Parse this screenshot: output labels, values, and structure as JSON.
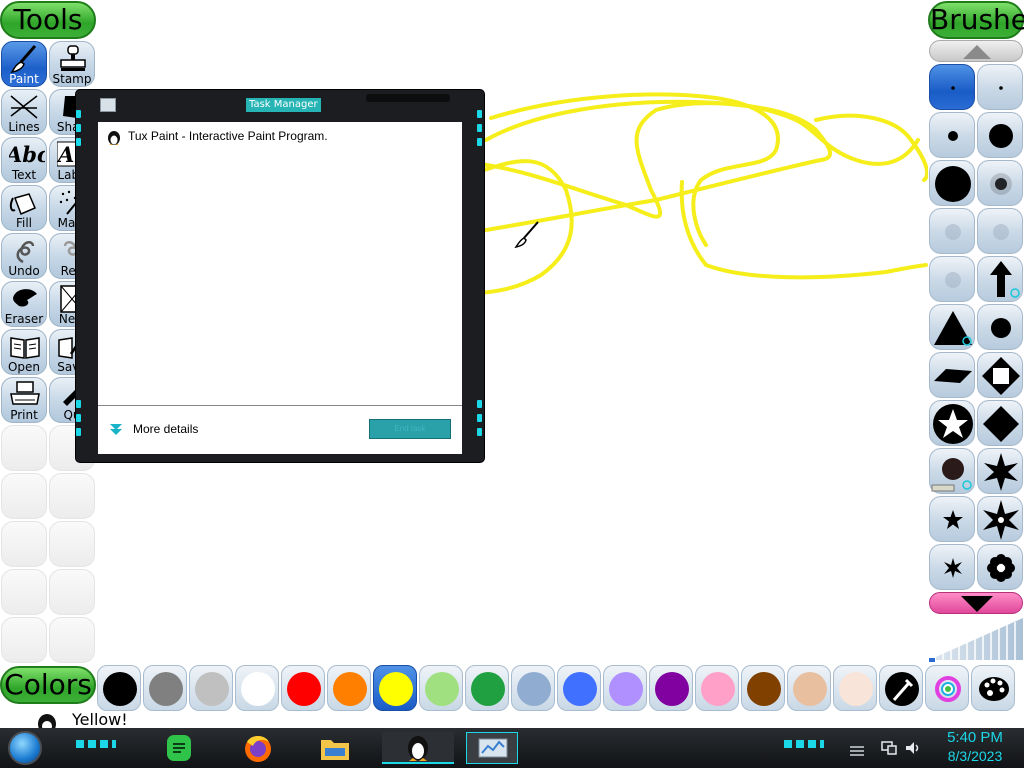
{
  "toolbar_left": {
    "header": "Tools",
    "tools": [
      {
        "label": "Paint",
        "icon": "paintbrush-icon",
        "selected": true
      },
      {
        "label": "Stamp",
        "icon": "stamp-icon"
      },
      {
        "label": "Lines",
        "icon": "lines-icon"
      },
      {
        "label": "Shap",
        "icon": "shapes-icon"
      },
      {
        "label": "Text",
        "icon": "text-icon",
        "glyph": "Abc"
      },
      {
        "label": "Labe",
        "icon": "label-icon",
        "glyph": "Ab"
      },
      {
        "label": "Fill",
        "icon": "fill-bucket-icon"
      },
      {
        "label": "Magi",
        "icon": "magic-wand-icon"
      },
      {
        "label": "Undo",
        "icon": "undo-icon"
      },
      {
        "label": "Red",
        "icon": "redo-icon"
      },
      {
        "label": "Eraser",
        "icon": "eraser-icon"
      },
      {
        "label": "New",
        "icon": "new-page-icon"
      },
      {
        "label": "Open",
        "icon": "open-book-icon"
      },
      {
        "label": "Save",
        "icon": "save-icon"
      },
      {
        "label": "Print",
        "icon": "printer-icon"
      },
      {
        "label": "Qu",
        "icon": "quit-icon"
      }
    ]
  },
  "toolbar_right": {
    "header": "Brushes"
  },
  "colors": {
    "header": "Colors",
    "swatches": [
      "#000000",
      "#808080",
      "#c0c0c0",
      "#ffffff",
      "#ff0000",
      "#ff8000",
      "#ffff00",
      "#a0e080",
      "#20a040",
      "#90acd0",
      "#4070ff",
      "#b090ff",
      "#8000a0",
      "#ff a0c8",
      "#804000",
      "#e8c0a0",
      "#f8e4d8"
    ],
    "selected_index": 6
  },
  "status": {
    "text": "Yellow!"
  },
  "task_manager": {
    "title": "Task Manager",
    "app_entry": "Tux Paint - Interactive Paint Program.",
    "more_details": "More details",
    "end_task_button": "End task"
  },
  "taskbar": {
    "time": "5:40 PM",
    "date": "8/3/2023"
  }
}
